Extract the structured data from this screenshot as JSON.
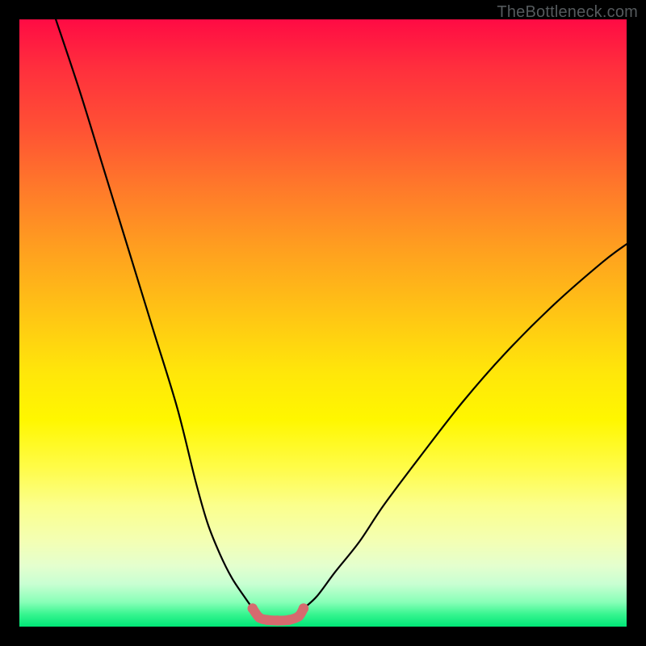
{
  "watermark": "TheBottleneck.com",
  "chart_data": {
    "type": "line",
    "title": "",
    "xlabel": "",
    "ylabel": "",
    "xlim": [
      0,
      100
    ],
    "ylim": [
      0,
      100
    ],
    "grid": false,
    "legend": false,
    "series": [
      {
        "name": "left-curve",
        "color": "#000000",
        "x": [
          6,
          10,
          14,
          18,
          22,
          26,
          29,
          31,
          33,
          35,
          37,
          38.4
        ],
        "y": [
          100,
          88,
          75,
          62,
          49,
          36,
          24,
          17,
          12,
          8,
          5,
          3
        ]
      },
      {
        "name": "right-curve",
        "color": "#000000",
        "x": [
          46.8,
          49,
          52,
          56,
          60,
          66,
          73,
          80,
          88,
          96,
          100
        ],
        "y": [
          3,
          5,
          9,
          14,
          20,
          28,
          37,
          45,
          53,
          60,
          63
        ]
      },
      {
        "name": "valley-marker",
        "color": "#d66a6f",
        "x": [
          38.4,
          39.5,
          40.8,
          42.5,
          44.4,
          46,
          46.8
        ],
        "y": [
          3,
          1.5,
          1.1,
          1.0,
          1.1,
          1.7,
          3
        ]
      }
    ],
    "color_scale": {
      "type": "vertical-gradient",
      "meaning": "red-top = high bottleneck, green-bottom = low bottleneck",
      "stops": [
        {
          "pos": 0.0,
          "color": "#ff0b44"
        },
        {
          "pos": 0.18,
          "color": "#ff5134"
        },
        {
          "pos": 0.38,
          "color": "#ffa01f"
        },
        {
          "pos": 0.58,
          "color": "#ffe60a"
        },
        {
          "pos": 0.8,
          "color": "#fbff8c"
        },
        {
          "pos": 0.93,
          "color": "#c8ffd2"
        },
        {
          "pos": 1.0,
          "color": "#00e676"
        }
      ]
    }
  }
}
